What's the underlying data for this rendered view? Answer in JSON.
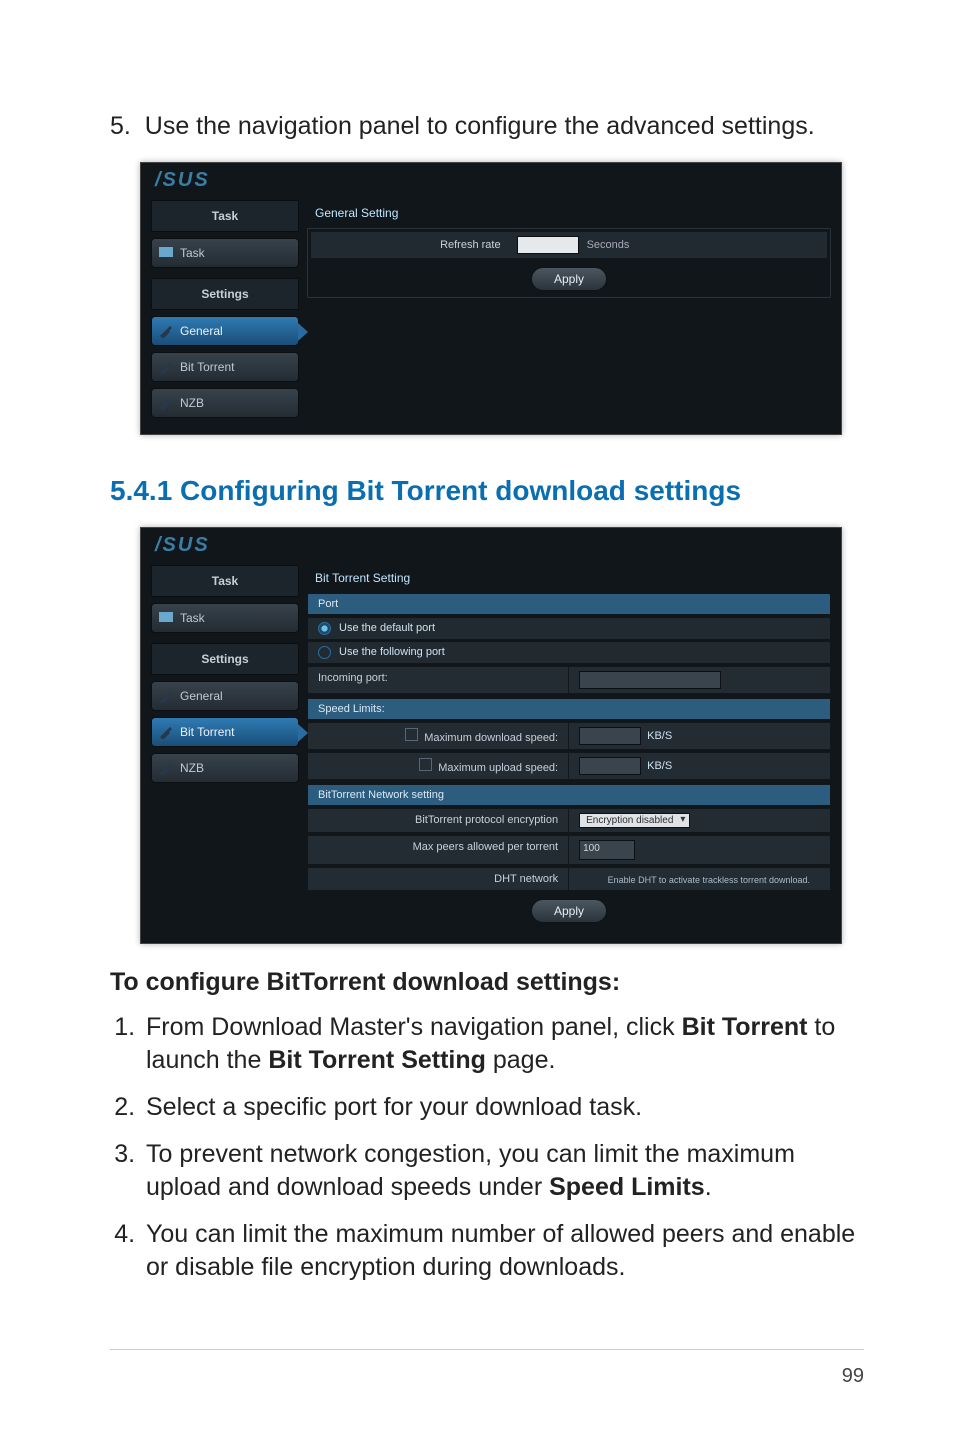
{
  "top_step": {
    "num": "5.",
    "text": "Use the navigation panel to configure the advanced settings."
  },
  "shot1": {
    "logo": "/SUS",
    "side": {
      "task_head": "Task",
      "task_item": "Task",
      "settings_head": "Settings",
      "items": [
        {
          "label": "General",
          "active": true
        },
        {
          "label": "Bit Torrent",
          "active": false
        },
        {
          "label": "NZB",
          "active": false
        }
      ]
    },
    "content": {
      "title": "General Setting",
      "refresh_label": "Refresh rate",
      "seconds_label": "Seconds",
      "apply": "Apply"
    }
  },
  "section_title": "5.4.1 Configuring Bit Torrent download settings",
  "shot2": {
    "logo": "/SUS",
    "side": {
      "task_head": "Task",
      "task_item": "Task",
      "settings_head": "Settings",
      "items": [
        {
          "label": "General",
          "active": false
        },
        {
          "label": "Bit Torrent",
          "active": true
        },
        {
          "label": "NZB",
          "active": false
        }
      ]
    },
    "content": {
      "title": "Bit Torrent Setting",
      "port_head": "Port",
      "radio_default": "Use the default port",
      "radio_following": "Use the following port",
      "incoming_port": "Incoming port:",
      "speed_head": "Speed Limits:",
      "max_down": "Maximum download speed:",
      "max_up": "Maximum upload speed:",
      "kbs": "KB/S",
      "net_head": "BitTorrent Network setting",
      "proto_enc": "BitTorrent protocol encryption",
      "enc_value": "Encryption disabled",
      "max_peers": "Max peers allowed per torrent",
      "max_peers_value": "100",
      "dht": "DHT network",
      "dht_note": "Enable DHT to activate trackless torrent download.",
      "apply": "Apply"
    }
  },
  "sub_title": "To configure BitTorrent download settings:",
  "steps": [
    {
      "pre": "From Download Master's navigation panel, click ",
      "b1": "Bit Torrent",
      "mid": " to launch the ",
      "b2": "Bit Torrent Setting",
      "post": " page."
    },
    {
      "pre": "Select a specific port for your download task."
    },
    {
      "pre": "To prevent network congestion, you can limit the maximum upload and download speeds under ",
      "b1": "Speed Limits",
      "post": "."
    },
    {
      "pre": "You can limit the maximum number of allowed peers and enable or disable file encryption during downloads."
    }
  ],
  "page_number": "99"
}
